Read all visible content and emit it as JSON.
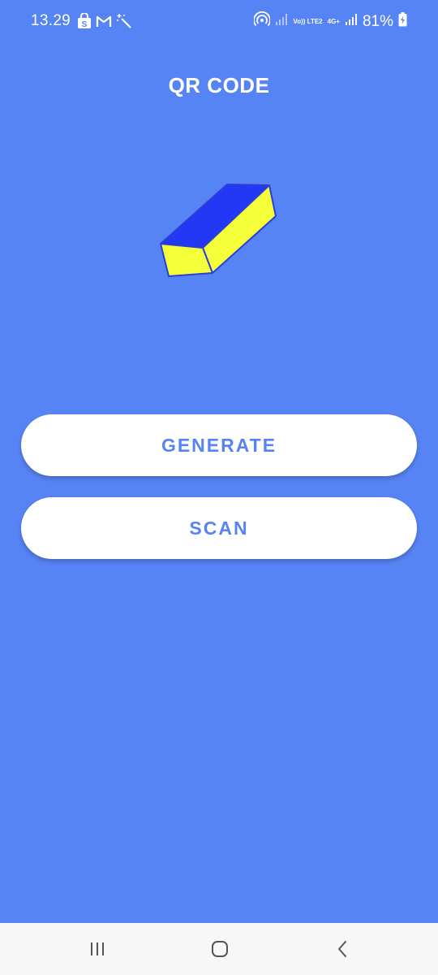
{
  "status_bar": {
    "time": "13.29",
    "left_icons": [
      "shopping-bag-icon",
      "gmail-icon",
      "magic-wand-icon"
    ],
    "tech_top": "Vo)) LTE2",
    "tech_network": "4G+",
    "battery_percent": "81%"
  },
  "app": {
    "title": "QR CODE",
    "logo": "yellow-blue-block-logo",
    "colors": {
      "background": "#5784f5",
      "button_bg": "#ffffff",
      "button_text": "#5784f5",
      "logo_top": "#2238f5",
      "logo_face": "#f4ff3a"
    }
  },
  "buttons": {
    "generate": "GENERATE",
    "scan": "SCAN"
  },
  "nav_bar": {
    "items": [
      "recent-apps-icon",
      "home-icon",
      "back-icon"
    ]
  }
}
